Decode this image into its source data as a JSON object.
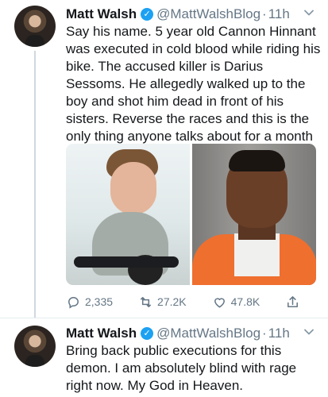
{
  "tweets": [
    {
      "author_name": "Matt Walsh",
      "verified_icon": "verified-badge-icon",
      "handle": "@MattWalshBlog",
      "separator": "·",
      "time": "11h",
      "text": "Say his name. 5 year old Cannon Hinnant was executed in cold blood while riding his bike. The accused killer is Darius Sessoms. He allegedly walked up to the boy and shot him dead in front of his sisters. Reverse the races and this is the only thing anyone talks about for a month",
      "actions": {
        "replies": "2,335",
        "retweets": "27.2K",
        "likes": "47.8K"
      }
    },
    {
      "author_name": "Matt Walsh",
      "verified_icon": "verified-badge-icon",
      "handle": "@MattWalshBlog",
      "separator": "·",
      "time": "11h",
      "text": "Bring back public executions for this demon. I am absolutely blind with rage right now. My God in Heaven."
    }
  ],
  "colors": {
    "text": "#14171a",
    "secondary": "#657786",
    "verified": "#1da1f2",
    "divider": "#e6ecf0"
  }
}
